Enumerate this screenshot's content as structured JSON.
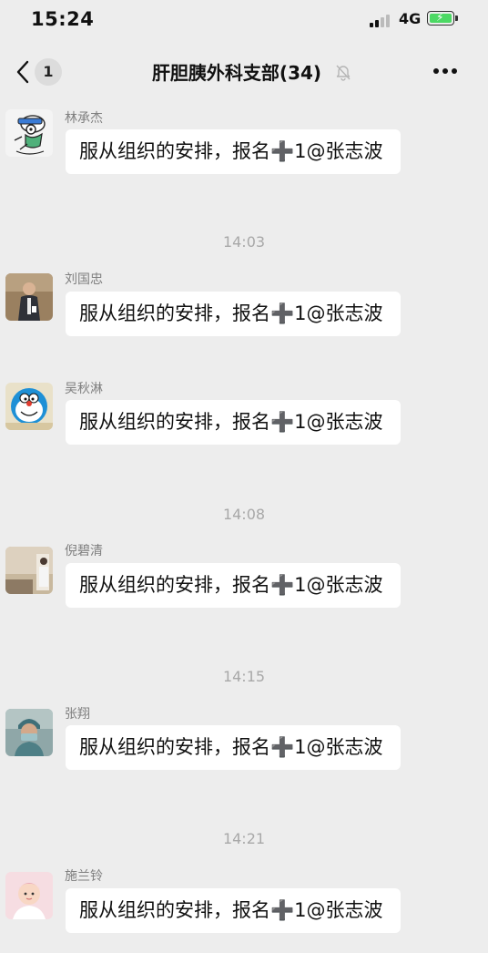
{
  "status_bar": {
    "time": "15:24",
    "network": "4G"
  },
  "nav": {
    "unread_count": "1",
    "title": "肝胆胰外科支部(34)"
  },
  "messages": [
    {
      "sender": "林承杰",
      "text": "服从组织的安排，报名➕1@张志波"
    },
    {
      "sender": "刘国忠",
      "text": "服从组织的安排，报名➕1@张志波"
    },
    {
      "sender": "吴秋淋",
      "text": "服从组织的安排，报名➕1@张志波"
    },
    {
      "sender": "倪碧清",
      "text": "服从组织的安排，报名➕1@张志波"
    },
    {
      "sender": "张翔",
      "text": "服从组织的安排，报名➕1@张志波"
    },
    {
      "sender": "施兰铃",
      "text": "服从组织的安排，报名➕1@张志波"
    }
  ],
  "timestamps": [
    "14:03",
    "14:08",
    "14:15",
    "14:21"
  ],
  "colors": {
    "background": "#ededed",
    "bubble": "#ffffff",
    "timestamp_text": "#a8a8a8",
    "sender_text": "#7f7f7f",
    "battery_fill": "#4cd964"
  },
  "icons": [
    "back-arrow-icon",
    "mute-bell-icon",
    "more-icon",
    "signal-icon",
    "battery-icon"
  ]
}
